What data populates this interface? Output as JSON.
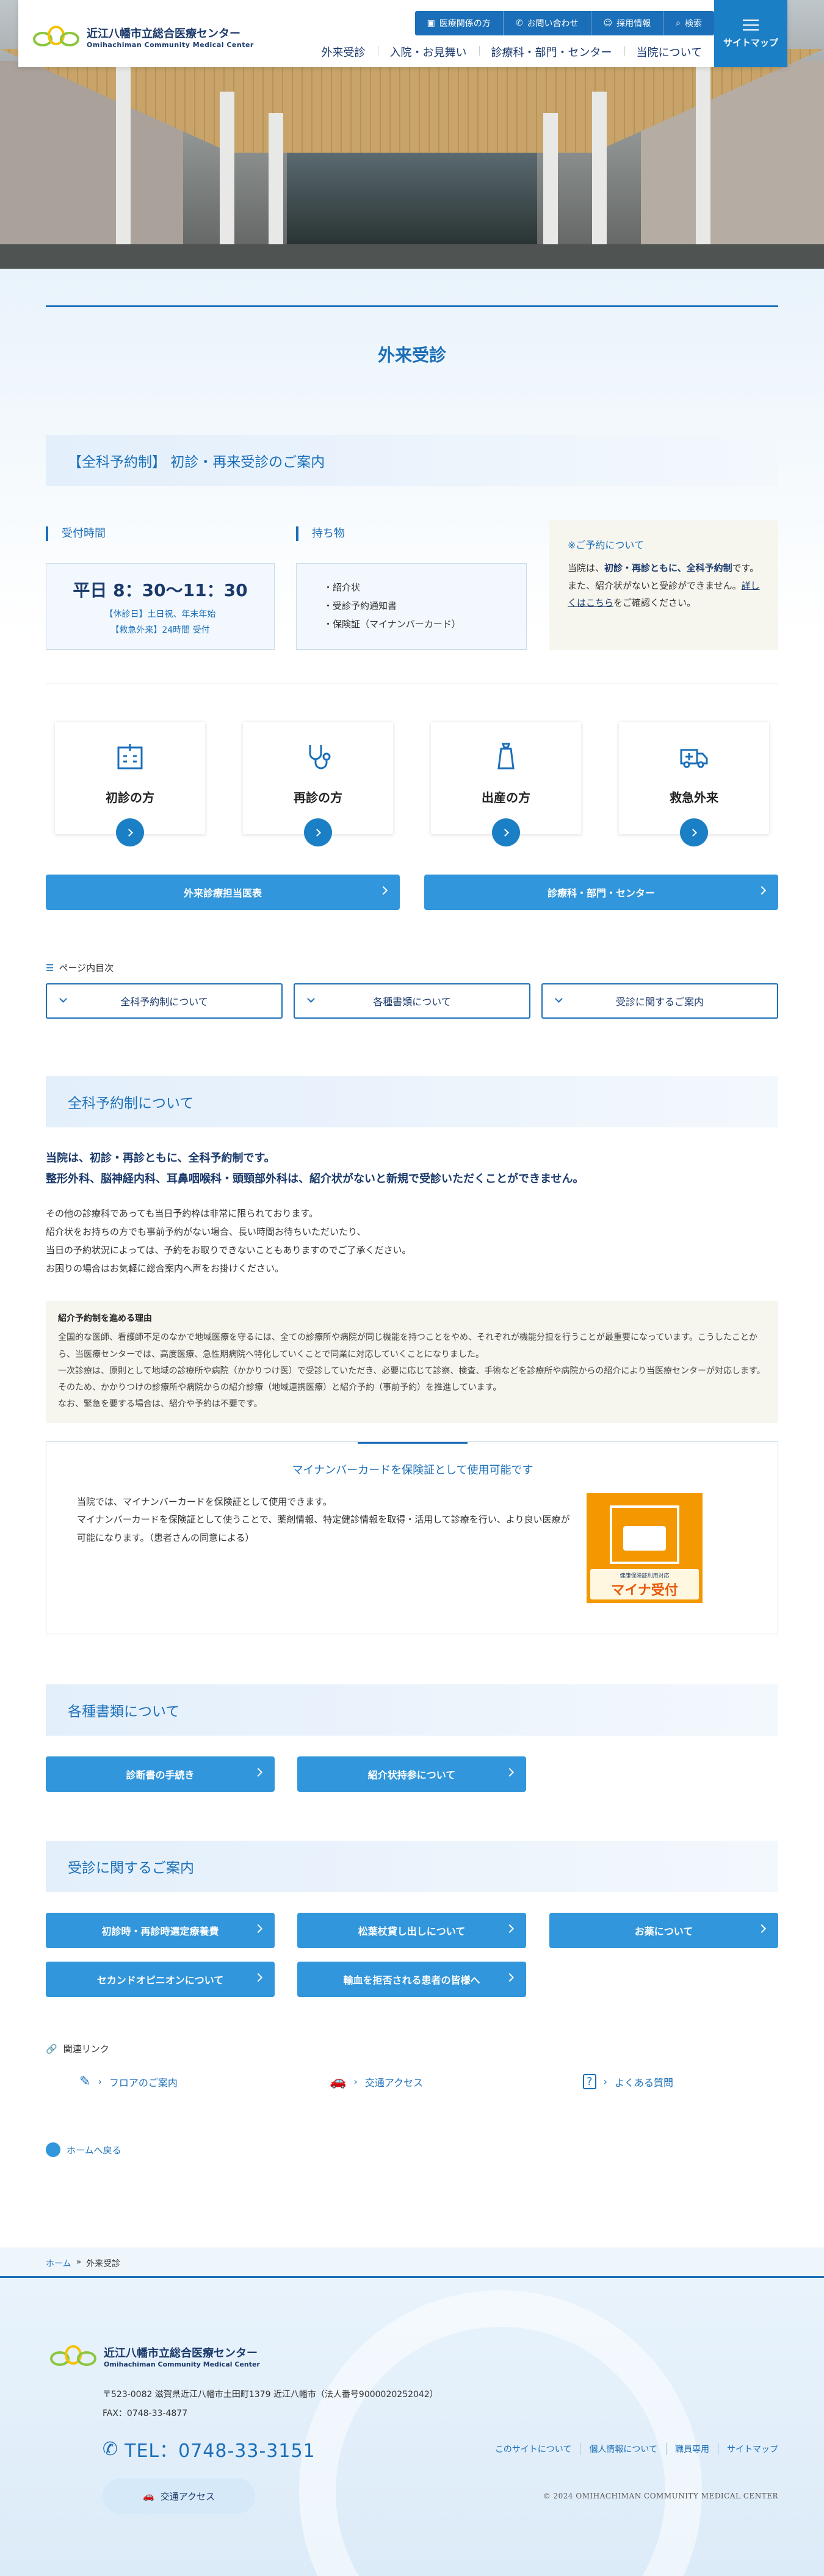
{
  "header": {
    "logo_jp": "近江八幡市立総合医療センター",
    "logo_en": "Omihachiman Community Medical Center",
    "util": [
      "医療関係の方",
      "お問い合わせ",
      "採用情報",
      "検索"
    ],
    "gnav": [
      "外来受診",
      "入院・お見舞い",
      "診療科・部門・センター",
      "当院について"
    ],
    "sitemap": "サイトマップ"
  },
  "page_title": "外来受診",
  "sec1": {
    "title": "【全科予約制】 初診・再来受診のご案内",
    "hours_h": "受付時間",
    "hours_main": "平日 8：30〜11：30",
    "hours_sub1": "【休診日】土日祝、年末年始",
    "hours_sub2": "【救急外来】24時間 受付",
    "items_h": "持ち物",
    "items": [
      "紹介状",
      "受診予約通知書",
      "保険証（マイナンバーカード）"
    ],
    "notice_h": "※ご予約について",
    "notice_1": "当院は、",
    "notice_2": "初診・再診ともに、全科予約制",
    "notice_3": "です。また、紹介状がないと受診ができません。",
    "notice_link": "詳しくはこちら",
    "notice_4": "をご確認ください。"
  },
  "cards": [
    "初診の方",
    "再診の方",
    "出産の方",
    "救急外来"
  ],
  "wide_buttons": [
    "外来診療担当医表",
    "診療科・部門・センター"
  ],
  "toc": {
    "label": "ページ内目次",
    "items": [
      "全科予約制について",
      "各種書類について",
      "受診に関するご案内"
    ]
  },
  "sec2": {
    "title": "全科予約制について",
    "lead1": "当院は、初診・再診ともに、全科予約制です。",
    "lead2": "整形外科、脳神経内科、耳鼻咽喉科・頭頸部外科は、紹介状がないと新規で受診いただくことができません。",
    "p1": "その他の診療科であっても当日予約枠は非常に限られております。",
    "p2": "紹介状をお持ちの方でも事前予約がない場合、長い時間お待ちいただいたり、",
    "p3": "当日の予約状況によっては、予約をお取りできないこともありますのでご了承ください。",
    "p4": "お困りの場合はお気軽に総合案内へ声をお掛けください。",
    "reason_h": "紹介予約制を進める理由",
    "r1": "全国的な医師、看護師不足のなかで地域医療を守るには、全ての診療所や病院が同じ機能を持つことをやめ、それぞれが機能分担を行うことが最重要になっています。こうしたことから、当医療センターでは、高度医療、急性期病院へ特化していくことで同業に対応していくことになりました。",
    "r2": "一次診療は、原則として地域の診療所や病院（かかりつけ医）で受診していただき、必要に応じて診察、検査、手術などを診療所や病院からの紹介により当医療センターが対応します。そのため、かかりつけの診療所や病院からの紹介診療（地域連携医療）と紹介予約（事前予約）を推進しています。",
    "r3": "なお、緊急を要する場合は、紹介や予約は不要です。",
    "mynum_h": "マイナンバーカードを保険証として使用可能です",
    "m1": "当院では、マイナンバーカードを保険証として使用できます。",
    "m2": "マイナンバーカードを保険証として使うことで、薬剤情報、特定健診情報を取得・活用して診療を行い、より良い医療が可能になります。（患者さんの同意による）",
    "poster_top": "健康保険証利用対応",
    "poster_text": "マイナ受付"
  },
  "sec3": {
    "title": "各種書類について",
    "buttons": [
      "診断書の手続き",
      "紹介状持参について"
    ]
  },
  "sec4": {
    "title": "受診に関するご案内",
    "buttons": [
      "初診時・再診時選定療養費",
      "松葉杖貸し出しについて",
      "お薬について",
      "セカンドオピニオンについて",
      "輸血を拒否される患者の皆様へ"
    ]
  },
  "related": {
    "label": "関連リンク",
    "links": [
      "フロアのご案内",
      "交通アクセス",
      "よくある質問"
    ]
  },
  "back_home": "ホームへ戻る",
  "breadcrumb": {
    "home": "ホーム",
    "sep": "»",
    "current": "外来受診"
  },
  "footer": {
    "logo_jp": "近江八幡市立総合医療センター",
    "logo_en": "Omihachiman Community Medical Center",
    "address": "〒523-0082 滋賀県近江八幡市土田町1379 近江八幡市（法人番号9000020252042）",
    "fax": "FAX：0748-33-4877",
    "tel": "TEL：0748-33-3151",
    "access": "交通アクセス",
    "links": [
      "このサイトについて",
      "個人情報について",
      "職員専用",
      "サイトマップ"
    ],
    "copyright": "© 2024 OMIHACHIMAN COMMUNITY MEDICAL CENTER"
  },
  "colors": {
    "primary": "#1b6fb8",
    "button": "#3196db",
    "navy": "#1b3a6b",
    "poster": "#f39800"
  }
}
